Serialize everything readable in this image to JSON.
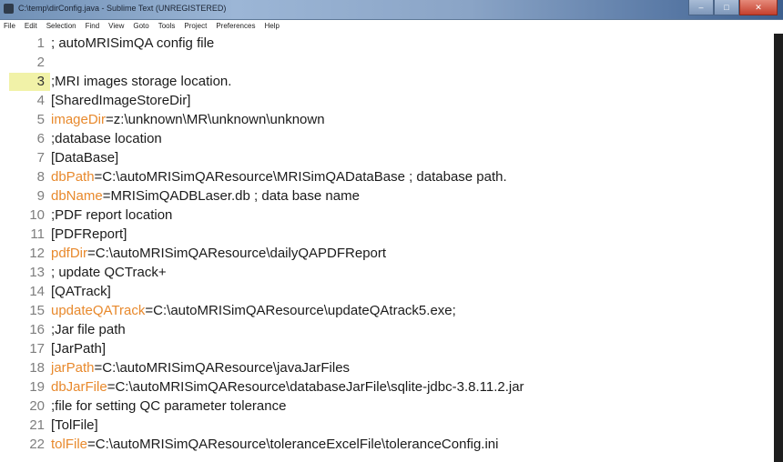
{
  "window": {
    "title": "C:\\temp\\dirConfig.java - Sublime Text (UNREGISTERED)",
    "minimize_glyph": "–",
    "maximize_glyph": "□",
    "close_glyph": "✕"
  },
  "menu": [
    "File",
    "Edit",
    "Selection",
    "Find",
    "View",
    "Goto",
    "Tools",
    "Project",
    "Preferences",
    "Help"
  ],
  "editor": {
    "current_line": 3,
    "lines": [
      {
        "num": "1",
        "key": "",
        "text": "; autoMRISimQA config file"
      },
      {
        "num": "2",
        "key": "",
        "text": ""
      },
      {
        "num": "3",
        "key": "",
        "text": ";MRI images storage location."
      },
      {
        "num": "4",
        "key": "",
        "text": "[SharedImageStoreDir]"
      },
      {
        "num": "5",
        "key": "imageDir",
        "text": "=z:\\unknown\\MR\\unknown\\unknown"
      },
      {
        "num": "6",
        "key": "",
        "text": ";database location"
      },
      {
        "num": "7",
        "key": "",
        "text": "[DataBase]"
      },
      {
        "num": "8",
        "key": "dbPath",
        "text": "=C:\\autoMRISimQAResource\\MRISimQADataBase ; database path."
      },
      {
        "num": "9",
        "key": "dbName",
        "text": "=MRISimQADBLaser.db ; data base name"
      },
      {
        "num": "10",
        "key": "",
        "text": ";PDF report location"
      },
      {
        "num": "11",
        "key": "",
        "text": "[PDFReport]"
      },
      {
        "num": "12",
        "key": "pdfDir",
        "text": "=C:\\autoMRISimQAResource\\dailyQAPDFReport"
      },
      {
        "num": "13",
        "key": "",
        "text": "; update QCTrack+"
      },
      {
        "num": "14",
        "key": "",
        "text": "[QATrack]"
      },
      {
        "num": "15",
        "key": "updateQATrack",
        "text": "=C:\\autoMRISimQAResource\\updateQAtrack5.exe;"
      },
      {
        "num": "16",
        "key": "",
        "text": ";Jar file path"
      },
      {
        "num": "17",
        "key": "",
        "text": "[JarPath]"
      },
      {
        "num": "18",
        "key": "jarPath",
        "text": "=C:\\autoMRISimQAResource\\javaJarFiles"
      },
      {
        "num": "19",
        "key": "dbJarFile",
        "text": "=C:\\autoMRISimQAResource\\databaseJarFile\\sqlite-jdbc-3.8.11.2.jar"
      },
      {
        "num": "20",
        "key": "",
        "text": ";file for setting QC parameter tolerance"
      },
      {
        "num": "21",
        "key": "",
        "text": "[TolFile]"
      },
      {
        "num": "22",
        "key": "tolFile",
        "text": "=C:\\autoMRISimQAResource\\toleranceExcelFile\\toleranceConfig.ini"
      }
    ]
  },
  "colors": {
    "key": "#e8892c",
    "text": "#1b1b1b",
    "line_number": "#7e7e7e",
    "current_line_highlight": "#f1f2a8"
  }
}
